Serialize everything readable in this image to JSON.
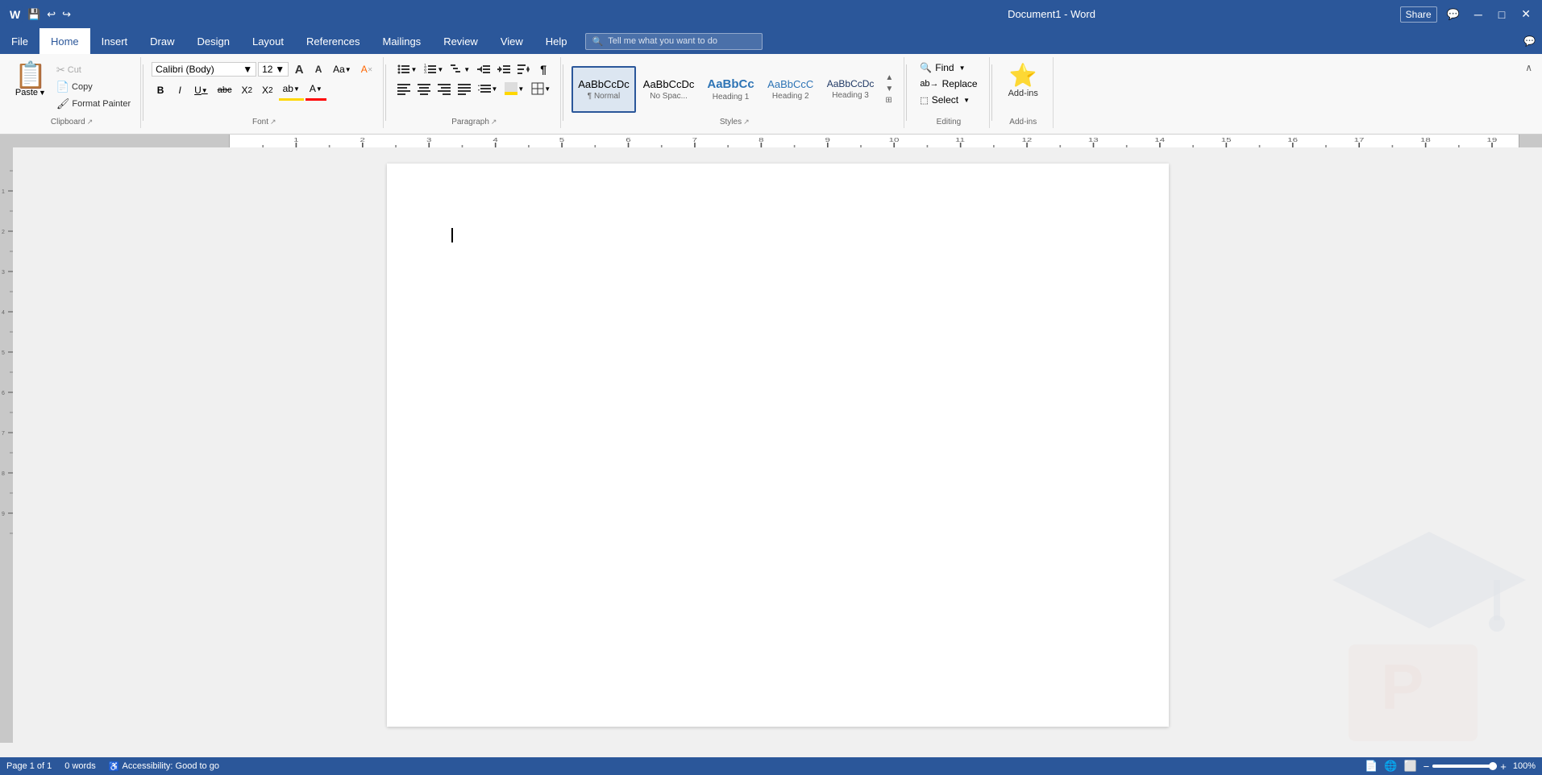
{
  "titlebar": {
    "title": "Document1 - Word",
    "minimize": "─",
    "maximize": "□",
    "close": "✕"
  },
  "menubar": {
    "items": [
      "File",
      "Home",
      "Insert",
      "Draw",
      "Design",
      "Layout",
      "References",
      "Mailings",
      "Review",
      "View",
      "Help"
    ],
    "active": "Home",
    "search_placeholder": "Tell me what you want to do",
    "chat_icon": "💬"
  },
  "ribbon": {
    "clipboard": {
      "group_label": "Clipboard",
      "paste_label": "Paste",
      "cut_label": "Cut",
      "copy_label": "Copy",
      "format_painter_label": "Format Painter"
    },
    "font": {
      "group_label": "Font",
      "font_name": "Calibri (Body)",
      "font_size": "12",
      "grow_label": "A",
      "shrink_label": "A",
      "case_label": "Aa",
      "clear_label": "A",
      "bold_label": "B",
      "italic_label": "I",
      "underline_label": "U",
      "strikethrough_label": "abc",
      "subscript_label": "X₂",
      "superscript_label": "X²",
      "highlight_label": "ab",
      "font_color_label": "A"
    },
    "paragraph": {
      "group_label": "Paragraph",
      "bullet_label": "≡",
      "number_label": "≡",
      "multilevel_label": "≡",
      "decrease_indent": "←",
      "increase_indent": "→",
      "sort_label": "↕",
      "show_marks_label": "¶",
      "align_left": "≡",
      "align_center": "≡",
      "align_right": "≡",
      "justify": "≡",
      "line_spacing": "↕",
      "shading": "▧",
      "borders": "⊞"
    },
    "styles": {
      "group_label": "Styles",
      "items": [
        {
          "label": "Normal",
          "sublabel": "¶ Normal",
          "selected": true,
          "preview": "AaBbCcDc"
        },
        {
          "label": "No Spac...",
          "sublabel": "AaBbCcDc",
          "selected": false,
          "preview": "AaBbCcDc"
        },
        {
          "label": "Heading 1",
          "sublabel": "",
          "selected": false,
          "preview": "AaBbCc"
        },
        {
          "label": "Heading 2",
          "sublabel": "",
          "selected": false,
          "preview": "AaBbCcC"
        },
        {
          "label": "Heading 3",
          "sublabel": "",
          "selected": false,
          "preview": "AaBbCcDc"
        }
      ]
    },
    "editing": {
      "group_label": "Editing",
      "find_label": "Find",
      "replace_label": "Replace",
      "select_label": "Select"
    },
    "addins": {
      "group_label": "Add-ins",
      "label": "Add-ins"
    }
  },
  "document": {
    "page_info": "Page 1 of 1",
    "word_count": "0 words",
    "accessibility": "Accessibility: Good to go"
  },
  "statusbar": {
    "page": "Page 1 of 1",
    "words": "0 words",
    "accessibility": "Accessibility: Good to go",
    "zoom": "100%"
  }
}
